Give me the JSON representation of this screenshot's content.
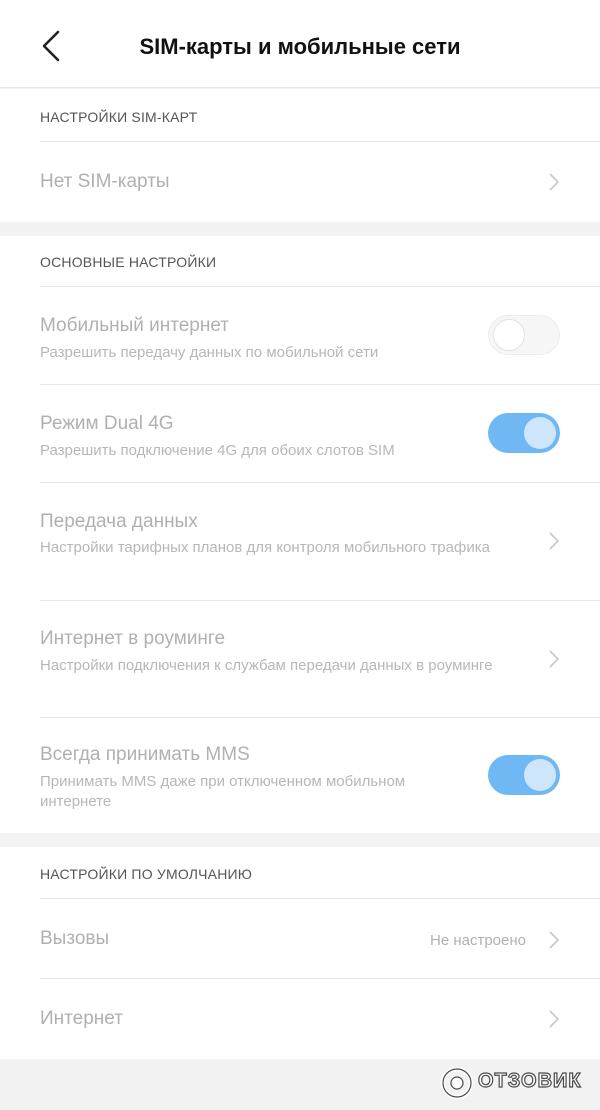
{
  "header": {
    "title": "SIM-карты и мобильные сети",
    "back_icon": "chevron-left-icon"
  },
  "sim_section": {
    "header": "НАСТРОЙКИ SIM-КАРТ",
    "items": [
      {
        "title": "Нет SIM-карты",
        "icon": "chevron-right-icon"
      }
    ]
  },
  "basic_section": {
    "header": "ОСНОВНЫЕ НАСТРОЙКИ",
    "items": [
      {
        "title": "Мобильный интернет",
        "subtitle": "Разрешить передачу данных по мобильной сети",
        "toggle": false
      },
      {
        "title": "Режим Dual 4G",
        "subtitle": "Разрешить подключение 4G для обоих слотов SIM",
        "toggle": true
      },
      {
        "title": "Передача данных",
        "subtitle": "Настройки тарифных планов для контроля мобильного трафика",
        "icon": "chevron-right-icon"
      },
      {
        "title": "Интернет в роуминге",
        "subtitle": "Настройки подключения к службам передачи данных в роуминге",
        "icon": "chevron-right-icon"
      },
      {
        "title": "Всегда принимать MMS",
        "subtitle": "Принимать MMS даже при отключенном мобильном интернете",
        "toggle": true
      }
    ]
  },
  "default_section": {
    "header": "НАСТРОЙКИ ПО УМОЛЧАНИЮ",
    "items": [
      {
        "title": "Вызовы",
        "value": "Не настроено",
        "icon": "chevron-right-icon"
      },
      {
        "title": "Интернет",
        "icon": "chevron-right-icon"
      }
    ]
  },
  "watermark": {
    "text": "ОТЗОВИК"
  },
  "colors": {
    "toggle_on": "#6fb8f4",
    "toggle_knob_on": "#cde6fb",
    "background": "#f2f2f2",
    "disabled_text": "#b0b0b0"
  }
}
